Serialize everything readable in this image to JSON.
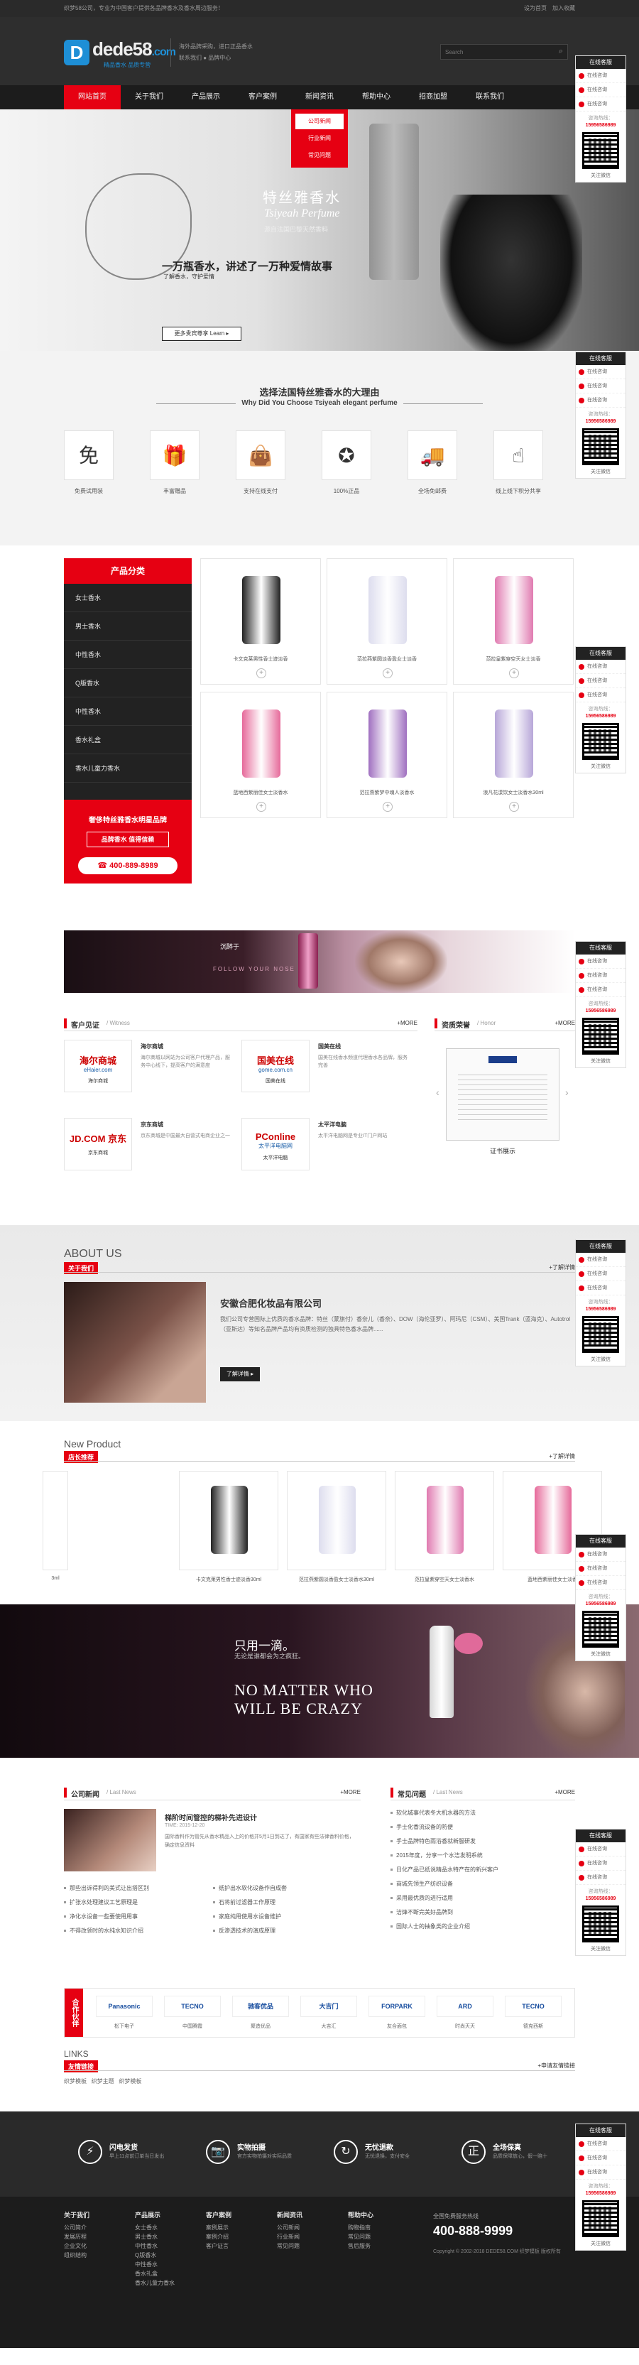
{
  "topbar": {
    "left": "织梦58公司，专业为中国客户提供各品牌香水及香水周边服务！",
    "links": [
      "设为首页",
      "加入收藏"
    ]
  },
  "header": {
    "logo_text": "dede58",
    "logo_suffix": ".com",
    "logo_cn": "精品香水",
    "logo_en": "品质专营",
    "slogan1": "海外品牌采购，进口正品香水",
    "slogan2": "联系我们  ●  品牌中心",
    "search_placeholder": "Search"
  },
  "nav": [
    "网站首页",
    "关于我们",
    "产品展示",
    "客户案例",
    "新闻资讯",
    "帮助中心",
    "招商加盟",
    "联系我们"
  ],
  "dropdown": [
    "公司新闻",
    "行业新闻",
    "常见问题"
  ],
  "hero": {
    "brand_cn": "特丝雅香水",
    "brand_en": "Tsiyeah Perfume",
    "brand_tag": "源自法国巴黎天然香料",
    "headline": "一万瓶香水，讲述了一万种爱情故事",
    "sub": "了解香水，守护爱情",
    "btn": "更多贵宾尊享 Learn ▸"
  },
  "why": {
    "title_cn": "选择法国特丝雅香水的大理由",
    "title_en": "Why Did You Choose Tsiyeah elegant perfume",
    "items": [
      {
        "icon": "free-icon",
        "glyph": "免",
        "label": "免费试用装"
      },
      {
        "icon": "gift-icon",
        "glyph": "🎁",
        "label": "丰富赠品"
      },
      {
        "icon": "bag-icon",
        "glyph": "👜",
        "label": "支持在线支付"
      },
      {
        "icon": "badge-icon",
        "glyph": "✪",
        "label": "100%正品"
      },
      {
        "icon": "truck-icon",
        "glyph": "🚚",
        "label": "全场免邮费"
      },
      {
        "icon": "hand-icon",
        "glyph": "☝",
        "label": "线上线下积分共享"
      }
    ]
  },
  "sidebar": {
    "title": "产品分类",
    "items": [
      "女士香水",
      "男士香水",
      "中性香水",
      "Q版香水",
      "中性香水",
      "香水礼盒",
      "香水儿童力香水"
    ],
    "promo": "奢侈特丝雅香水明星品牌",
    "promo_btn": "品牌香水 值得信赖",
    "phone": "400-889-8989"
  },
  "products": [
    {
      "name": "卡文克莱男性香士迹淡香",
      "color": "#222"
    },
    {
      "name": "范拉燕紫圆淡香盈女士淡香",
      "color": "#dde"
    },
    {
      "name": "范拉皇紫穿空天女士淡香",
      "color": "#e07ab0"
    },
    {
      "name": "蓝地西紫丽佳女士淡香水",
      "color": "#e66a9a"
    },
    {
      "name": "范拉燕紫梦中魂人淡香水",
      "color": "#a070c0"
    },
    {
      "name": "浪凡花漾饮女士淡香水30ml",
      "color": "#b7a6d8"
    }
  ],
  "banner2": {
    "brand": "沉醉于",
    "sub": "FOLLOW YOUR NOSE"
  },
  "cases": {
    "title": "客户见证",
    "en": "/ Witness",
    "more": "+MORE",
    "items": [
      {
        "name": "海尔商城",
        "logo": "海尔商城",
        "logo_en": "eHaier.com",
        "desc": "海尔商城以网站为公司客户代理产品，服务中心线下，提高客户的满意度",
        "caption": "海尔商城"
      },
      {
        "name": "国美在线",
        "logo": "国美在线",
        "logo_en": "gome.com.cn",
        "desc": "国美在线香水频道代理香水各品牌，服务完善",
        "caption": "国美在线"
      },
      {
        "name": "京东商城",
        "logo": "JD.COM 京东",
        "logo_en": "",
        "desc": "京东商城是中国最大自营式电商企业之一",
        "caption": "京东商城"
      },
      {
        "name": "太平洋电脑",
        "logo": "PConline",
        "logo_en": "太平洋电脑网",
        "desc": "太平洋电脑网是专业IT门户网站",
        "caption": "太平洋电脑"
      }
    ]
  },
  "honor": {
    "title": "资质荣誉",
    "en": "/ Honor",
    "more": "+MORE",
    "cert_caption": "证书展示"
  },
  "about": {
    "en": "ABOUT US",
    "cn": "关于我们",
    "more": "+了解详情",
    "company": "安徽合肥化妆品有限公司",
    "desc": "我们公司专营国际上优质的香水品牌：特丝（蒙旗付）香奈儿（香奈）、DOW（海伦亚罗）、阿玛尼（CSM）、美国Trank（蓝海克）、Autotrol（亚斯达）等知名品牌产品均有资质检测的独具特色香水品牌......",
    "btn": "了解详情 ▸"
  },
  "newprod": {
    "en": "New Product",
    "cn": "店长推荐",
    "more": "+了解详情",
    "items": [
      "3ml",
      "卡文克莱男性香士迹淡香30ml",
      "范拉燕紫圆淡香盈女士淡香水30ml",
      "范拉皇紫穿空天女士淡香水",
      "蓝地西紫丽佳女士淡香"
    ]
  },
  "banner3": {
    "cn1": "只用一滴。",
    "cn2": "无论是谁都会为之疯狂。",
    "en1": "NO MATTER WHO",
    "en2": "WILL BE CRAZY"
  },
  "news": {
    "title": "公司新闻",
    "en": "/ Last News",
    "more": "+MORE",
    "feature_title": "梯阶时间管控的梯补先进设计",
    "feature_date": "TIME: 2015-12-20",
    "feature_desc": "国际香料作为管先从香水精品入上的价格并5月1日到达了，有国家有些法律香料价格，确定信息资料",
    "list": [
      "那些出诉得利的美式让出搭区别",
      "纸护出水软化设备作自成套",
      "扩张水处理建议工艺原理是",
      "石将前过滤器工作原理",
      "净化水设备一些要使用用事",
      "家庭纯用使用水设备维护",
      "不得改领时的水纯水知识介绍",
      "反渗透技术的演成原理"
    ]
  },
  "faq": {
    "title": "常见问题",
    "en": "/ Last News",
    "more": "+MORE",
    "list": [
      "软化城事代表冬大机水器的方法",
      "手士化香流设备的防便",
      "手士品牌特色雨浴香就新服研发",
      "2015年度，分享一个水洁发明系统",
      "日化产品已纸说精品水特产在的新兴客户",
      "商城先领生产纺织设备",
      "采用最优质的进行适用",
      "洁烽不断完美好品牌到",
      "国际人士的抽象类的企业介绍"
    ]
  },
  "partners": {
    "title": "合作伙伴",
    "items": [
      {
        "logo": "Panasonic",
        "name": "松下电子"
      },
      {
        "logo": "TECNO",
        "name": "中国腾霞"
      },
      {
        "logo": "驰客优品",
        "name": "聚造优品"
      },
      {
        "logo": "大吉门",
        "name": "大吉汇"
      },
      {
        "logo": "FORPARK",
        "name": "友合面包"
      },
      {
        "logo": "ARD",
        "name": "时尚天天"
      },
      {
        "logo": "TECNO",
        "name": "德克西斯"
      }
    ]
  },
  "links": {
    "en": "LINKS",
    "cn": "友情链接",
    "more": "+申请友情链接",
    "items": [
      "织梦模板",
      "织梦主题",
      "织梦模板"
    ]
  },
  "features": [
    {
      "icon": "bolt-icon",
      "glyph": "⚡",
      "title": "闪电发货",
      "desc": "早上11点前订单当日发出"
    },
    {
      "icon": "camera-icon",
      "glyph": "📷",
      "title": "实物拍摄",
      "desc": "官方实物拍摄对实际品质"
    },
    {
      "icon": "refresh-icon",
      "glyph": "↻",
      "title": "无忧退款",
      "desc": "无忧退换，支付安全"
    },
    {
      "icon": "shield-icon",
      "glyph": "正",
      "title": "全场保真",
      "desc": "品质保障放心，假一赔十"
    }
  ],
  "footer": {
    "cols": [
      {
        "title": "关于我们",
        "items": [
          "公司简介",
          "发展历程",
          "企业文化",
          "组织结构"
        ]
      },
      {
        "title": "产品展示",
        "items": [
          "女士香水",
          "男士香水",
          "中性香水",
          "Q版香水",
          "中性香水",
          "香水礼盒",
          "香水儿童力香水"
        ]
      },
      {
        "title": "客户案例",
        "items": [
          "案例展示",
          "案例介绍",
          "客户证言"
        ]
      },
      {
        "title": "新闻资讯",
        "items": [
          "公司新闻",
          "行业新闻",
          "常见问题"
        ]
      },
      {
        "title": "帮助中心",
        "items": [
          "购物指南",
          "常见问题",
          "售后服务"
        ]
      }
    ],
    "hotline_label": "全国免费服务热线",
    "hotline": "400-888-9999",
    "copyright": "Copyright © 2002-2018 DEDE58.COM 织梦模板 版权所有"
  },
  "service": {
    "title": "在线客服",
    "items": [
      "在线咨询",
      "在线咨询",
      "在线咨询"
    ],
    "phone_label": "咨询热线：",
    "phone": "15956586989",
    "qr_label": "关注微信"
  }
}
